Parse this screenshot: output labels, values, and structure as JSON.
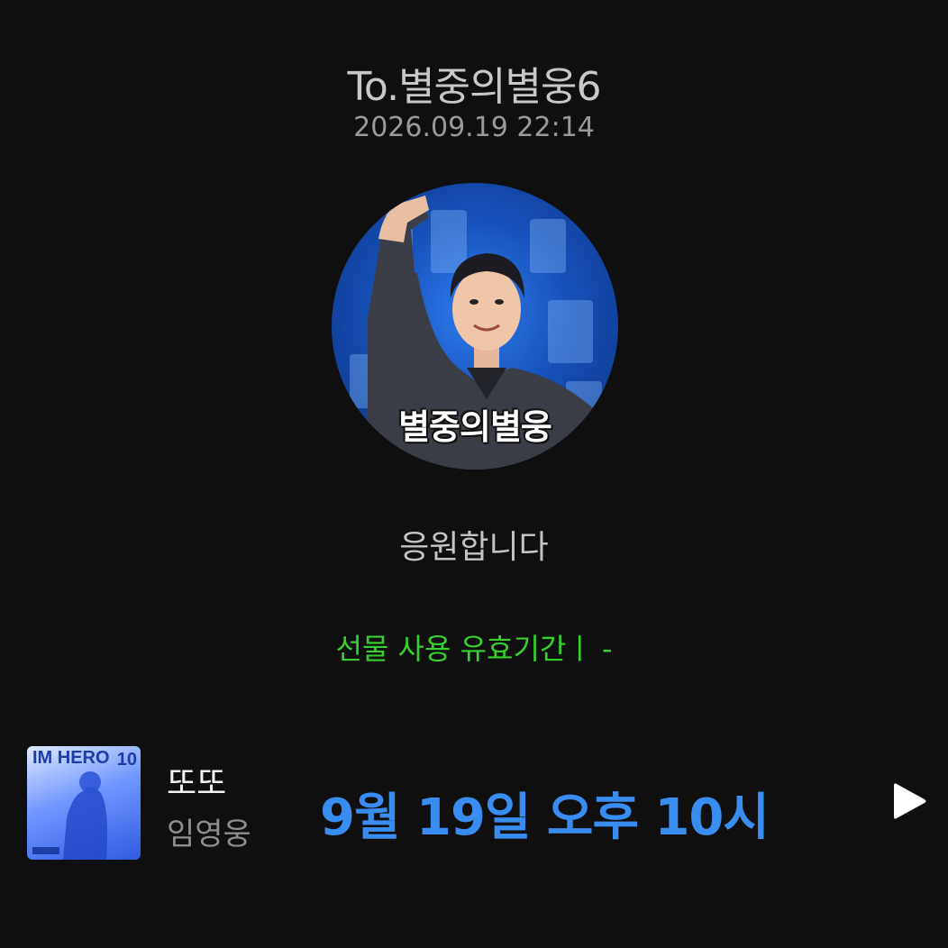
{
  "header": {
    "recipient": "To.별중의별웅6",
    "timestamp": "2026.09.19 22:14"
  },
  "avatar": {
    "caption": "별중의별웅"
  },
  "message": "응원합니다",
  "gift_validity": "선물 사용 유효기간ㅣ  -",
  "player": {
    "album_art_text": "IM HERO",
    "album_art_number": "10",
    "song_title": "또또",
    "artist": "임영웅",
    "schedule": "9월 19일 오후 10시",
    "play_icon": "play-icon"
  },
  "colors": {
    "background": "#0f0f10",
    "validity_text": "#36d12e",
    "schedule_text": "#3a8df0"
  }
}
